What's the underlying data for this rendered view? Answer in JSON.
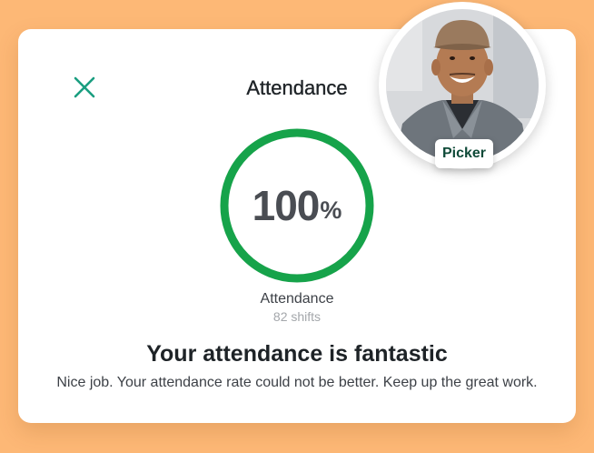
{
  "dialog": {
    "title": "Attendance",
    "close_icon": "close-icon"
  },
  "metric": {
    "value": "100",
    "unit": "%",
    "progress_fraction": 1.0,
    "label": "Attendance",
    "sublabel": "82 shifts",
    "ring_color": "#16a34a"
  },
  "message": {
    "headline": "Your attendance is fantastic",
    "body": "Nice job. Your attendance rate could not be better. Keep up the great work."
  },
  "profile": {
    "role": "Picker"
  },
  "colors": {
    "background": "#fdb876",
    "accent": "#1a9e80",
    "text_dark": "#1e2327",
    "badge_text": "#0f4a38"
  }
}
